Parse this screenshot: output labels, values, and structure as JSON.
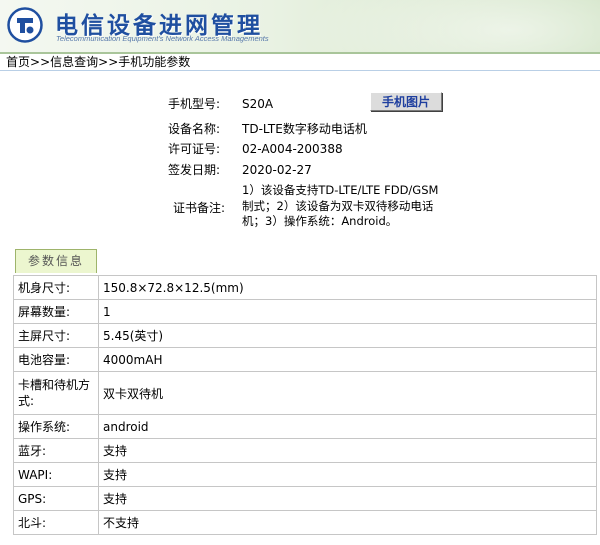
{
  "header": {
    "title": "电信设备进网管理",
    "subtitle": "Telecommunication Equipment's Network Access Managements",
    "brand_color": "#1f4fa0"
  },
  "breadcrumb": {
    "home": "首页",
    "sep1": ">>",
    "query": "信息查询",
    "sep2": ">>",
    "current": "手机功能参数"
  },
  "summary": {
    "model_label": "手机型号:",
    "model_value": "S20A",
    "photo_button": "手机图片",
    "name_label": "设备名称:",
    "name_value": "TD-LTE数字移动电话机",
    "license_label": "许可证号:",
    "license_value": "02-A004-200388",
    "date_label": "签发日期:",
    "date_value": "2020-02-27",
    "remark_label": "证书备注:",
    "remark_value": "1）该设备支持TD-LTE/LTE FDD/GSM制式；2）该设备为双卡双待移动电话机；3）操作系统：Android。"
  },
  "params": {
    "tab_label": "参数信息",
    "rows": [
      {
        "label": "机身尺寸:",
        "value": "150.8×72.8×12.5(mm)"
      },
      {
        "label": "屏幕数量:",
        "value": "1"
      },
      {
        "label": "主屏尺寸:",
        "value": "5.45(英寸)"
      },
      {
        "label": "电池容量:",
        "value": "4000mAH"
      },
      {
        "label": "卡槽和待机方式:",
        "value": "双卡双待机"
      },
      {
        "label": "操作系统:",
        "value": "android"
      },
      {
        "label": "蓝牙:",
        "value": "支持"
      },
      {
        "label": "WAPI:",
        "value": "支持"
      },
      {
        "label": "GPS:",
        "value": "支持"
      },
      {
        "label": "北斗:",
        "value": "不支持"
      }
    ]
  }
}
